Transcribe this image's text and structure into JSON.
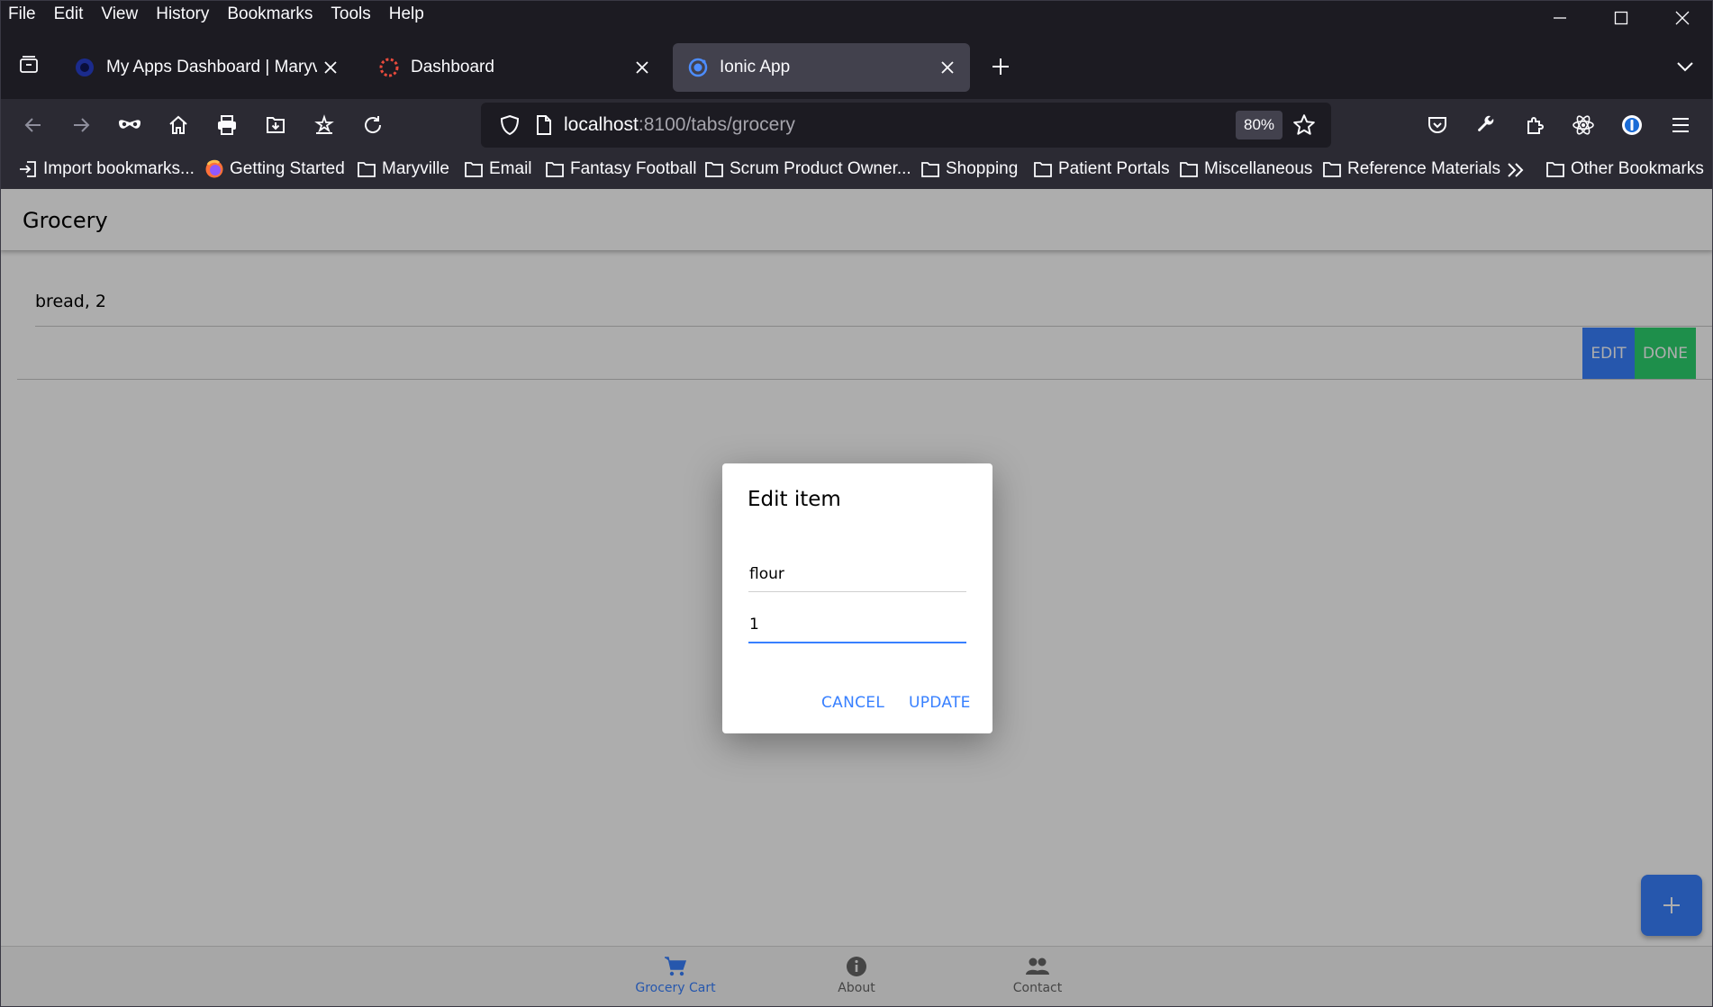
{
  "menubar": {
    "items": [
      "File",
      "Edit",
      "View",
      "History",
      "Bookmarks",
      "Tools",
      "Help"
    ]
  },
  "tabs": [
    {
      "title": "My Apps Dashboard | Maryville",
      "icon": "okta-icon",
      "active": false
    },
    {
      "title": "Dashboard",
      "icon": "ionic-ring-icon",
      "active": false
    },
    {
      "title": "Ionic App",
      "icon": "ionic-icon",
      "active": true
    }
  ],
  "urlbar": {
    "host": "localhost",
    "path": ":8100/tabs/grocery",
    "zoom": "80%"
  },
  "bookmarks": {
    "items": [
      {
        "label": "Import bookmarks...",
        "icon": "import-icon"
      },
      {
        "label": "Getting Started",
        "icon": "firefox-icon"
      },
      {
        "label": "Maryville",
        "icon": "folder-icon"
      },
      {
        "label": "Email",
        "icon": "folder-icon"
      },
      {
        "label": "Fantasy Football",
        "icon": "folder-icon"
      },
      {
        "label": "Scrum Product Owner...",
        "icon": "folder-icon"
      },
      {
        "label": "Shopping",
        "icon": "folder-icon"
      },
      {
        "label": "Patient Portals",
        "icon": "folder-icon"
      },
      {
        "label": "Miscellaneous",
        "icon": "folder-icon"
      },
      {
        "label": "Reference Materials",
        "icon": "folder-icon"
      }
    ],
    "other": "Other Bookmarks"
  },
  "app": {
    "title": "Grocery",
    "items": [
      {
        "text": "bread, 2"
      }
    ],
    "item_options": {
      "edit": "EDIT",
      "done": "DONE"
    },
    "tabbar": [
      {
        "label": "Grocery Cart",
        "icon": "cart-icon",
        "selected": true
      },
      {
        "label": "About",
        "icon": "info-icon",
        "selected": false
      },
      {
        "label": "Contact",
        "icon": "people-icon",
        "selected": false
      }
    ]
  },
  "dialog": {
    "title": "Edit item",
    "name_value": "flour",
    "quantity_value": "1",
    "cancel_label": "CANCEL",
    "update_label": "UPDATE"
  },
  "colors": {
    "ionic_primary": "#3880ff",
    "ionic_success": "#2dd36f",
    "browser_dark": "#1c1b22",
    "toolbar": "#2b2a33"
  }
}
